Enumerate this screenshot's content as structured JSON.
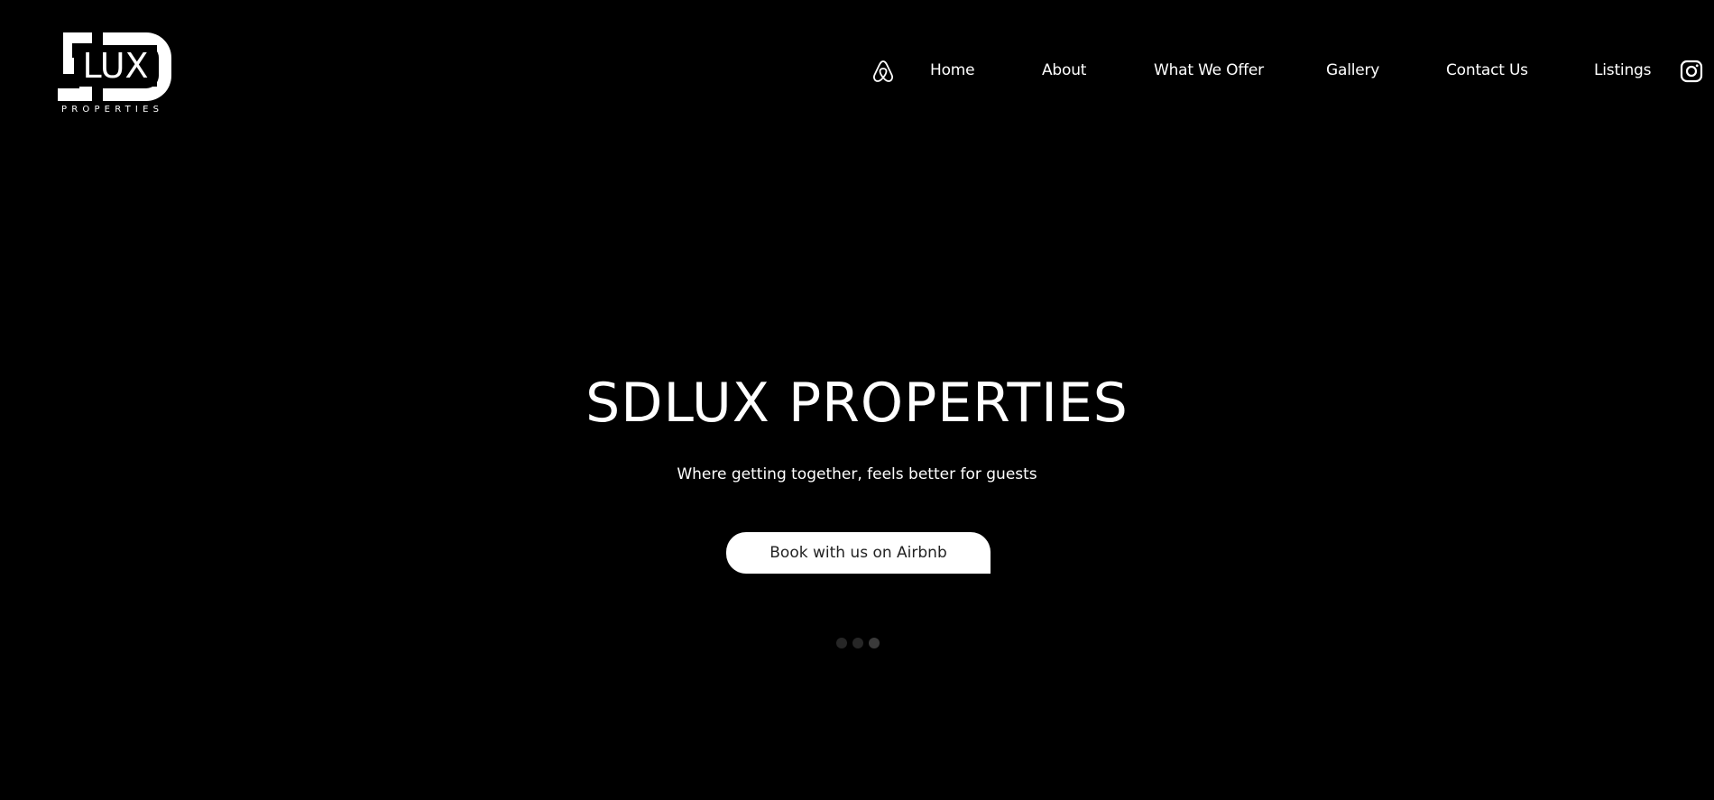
{
  "brand": {
    "logo_text": "LUX",
    "logo_subtext": "PROPERTIES"
  },
  "nav": {
    "airbnb_icon": "airbnb-icon",
    "items": [
      {
        "label": "Home"
      },
      {
        "label": "About"
      },
      {
        "label": "What We Offer"
      },
      {
        "label": "Gallery"
      },
      {
        "label": "Contact Us"
      },
      {
        "label": "Listings"
      }
    ],
    "instagram_icon": "instagram-icon"
  },
  "hero": {
    "title": "SDLUX PROPERTIES",
    "subtitle": "Where getting together, feels better for guests",
    "cta_label": "Book with us on Airbnb",
    "slides_total": 3,
    "active_slide": 3
  },
  "colors": {
    "background": "#000000",
    "text": "#ffffff",
    "button_bg": "#ffffff",
    "button_text": "#222222",
    "dot_inactive": "#262626",
    "dot_active": "#3a3a3a"
  }
}
